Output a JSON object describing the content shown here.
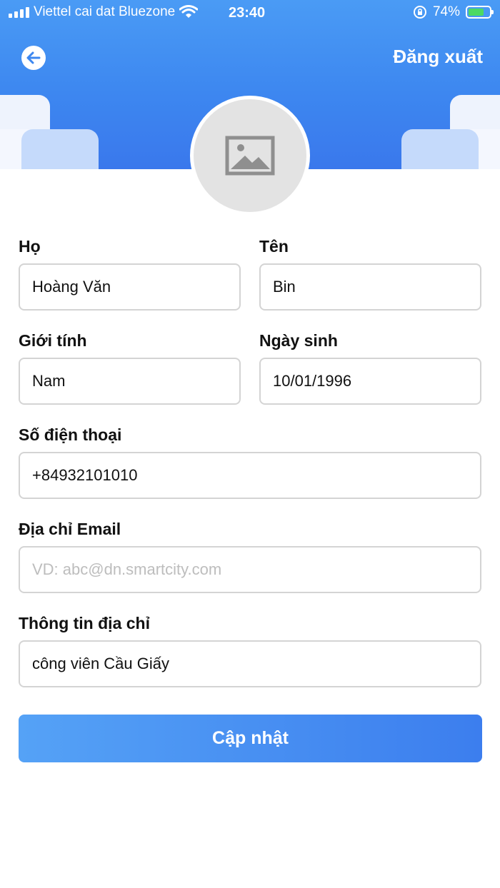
{
  "status_bar": {
    "carrier": "Viettel cai dat Bluezone",
    "time": "23:40",
    "battery": "74%",
    "battery_level": 0.74
  },
  "header": {
    "back_icon": "arrow-left-icon",
    "logout_label": "Đăng xuất",
    "avatar_icon": "image-placeholder-icon",
    "accent_color": "#3d87f0"
  },
  "form": {
    "last_name": {
      "label": "Họ",
      "value": "Hoàng Văn"
    },
    "first_name": {
      "label": "Tên",
      "value": "Bin"
    },
    "gender": {
      "label": "Giới tính",
      "value": "Nam"
    },
    "birthday": {
      "label": "Ngày sinh",
      "value": "10/01/1996"
    },
    "phone": {
      "label": "Số điện thoại",
      "value": "+84932101010"
    },
    "email": {
      "label": "Địa chỉ Email",
      "placeholder": "VD: abc@dn.smartcity.com"
    },
    "address": {
      "label": "Thông tin địa chỉ",
      "value": "công viên Cầu Giấy"
    }
  },
  "submit_label": "Cập nhật"
}
